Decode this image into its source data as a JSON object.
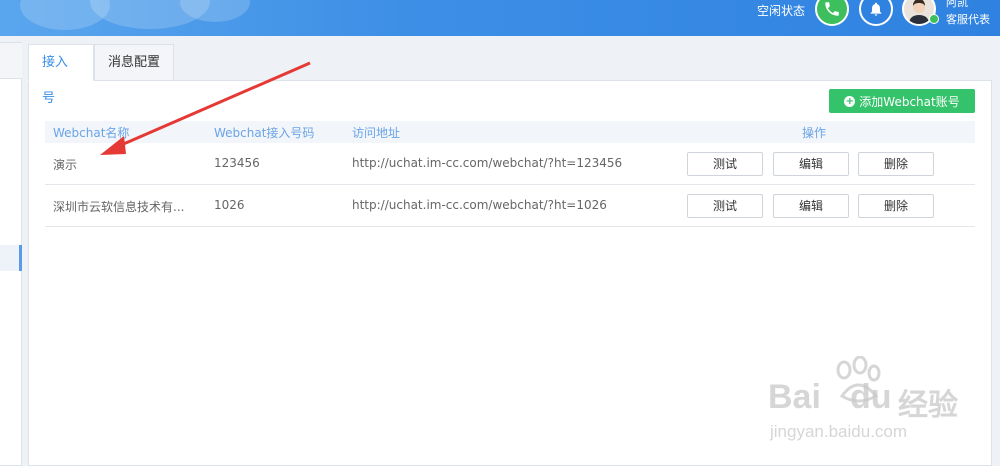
{
  "header": {
    "status_text": "空闲状态",
    "user_name": "阿凯",
    "user_role": "客服代表",
    "phone_icon": "phone-icon",
    "bell_icon": "bell-icon",
    "accent_color": "#2f82e0"
  },
  "tabs": [
    {
      "label": "接入号",
      "active": true
    },
    {
      "label": "消息配置",
      "active": false
    }
  ],
  "toolbar": {
    "add_label": "添加Webchat账号",
    "add_color": "#34c26a"
  },
  "table": {
    "columns": [
      "Webchat名称",
      "Webchat接入号码",
      "访问地址",
      "操作"
    ],
    "rows": [
      {
        "name": "演示",
        "number": "123456",
        "url": "http://uchat.im-cc.com/webchat/?ht=123456"
      },
      {
        "name": "深圳市云软信息技术有...",
        "number": "1026",
        "url": "http://uchat.im-cc.com/webchat/?ht=1026"
      }
    ],
    "actions": {
      "test": "测试",
      "edit": "编辑",
      "delete": "删除"
    }
  },
  "watermark": {
    "logo": "Bai",
    "logo2": "du",
    "cn": "经验",
    "url": "jingyan.baidu.com"
  }
}
